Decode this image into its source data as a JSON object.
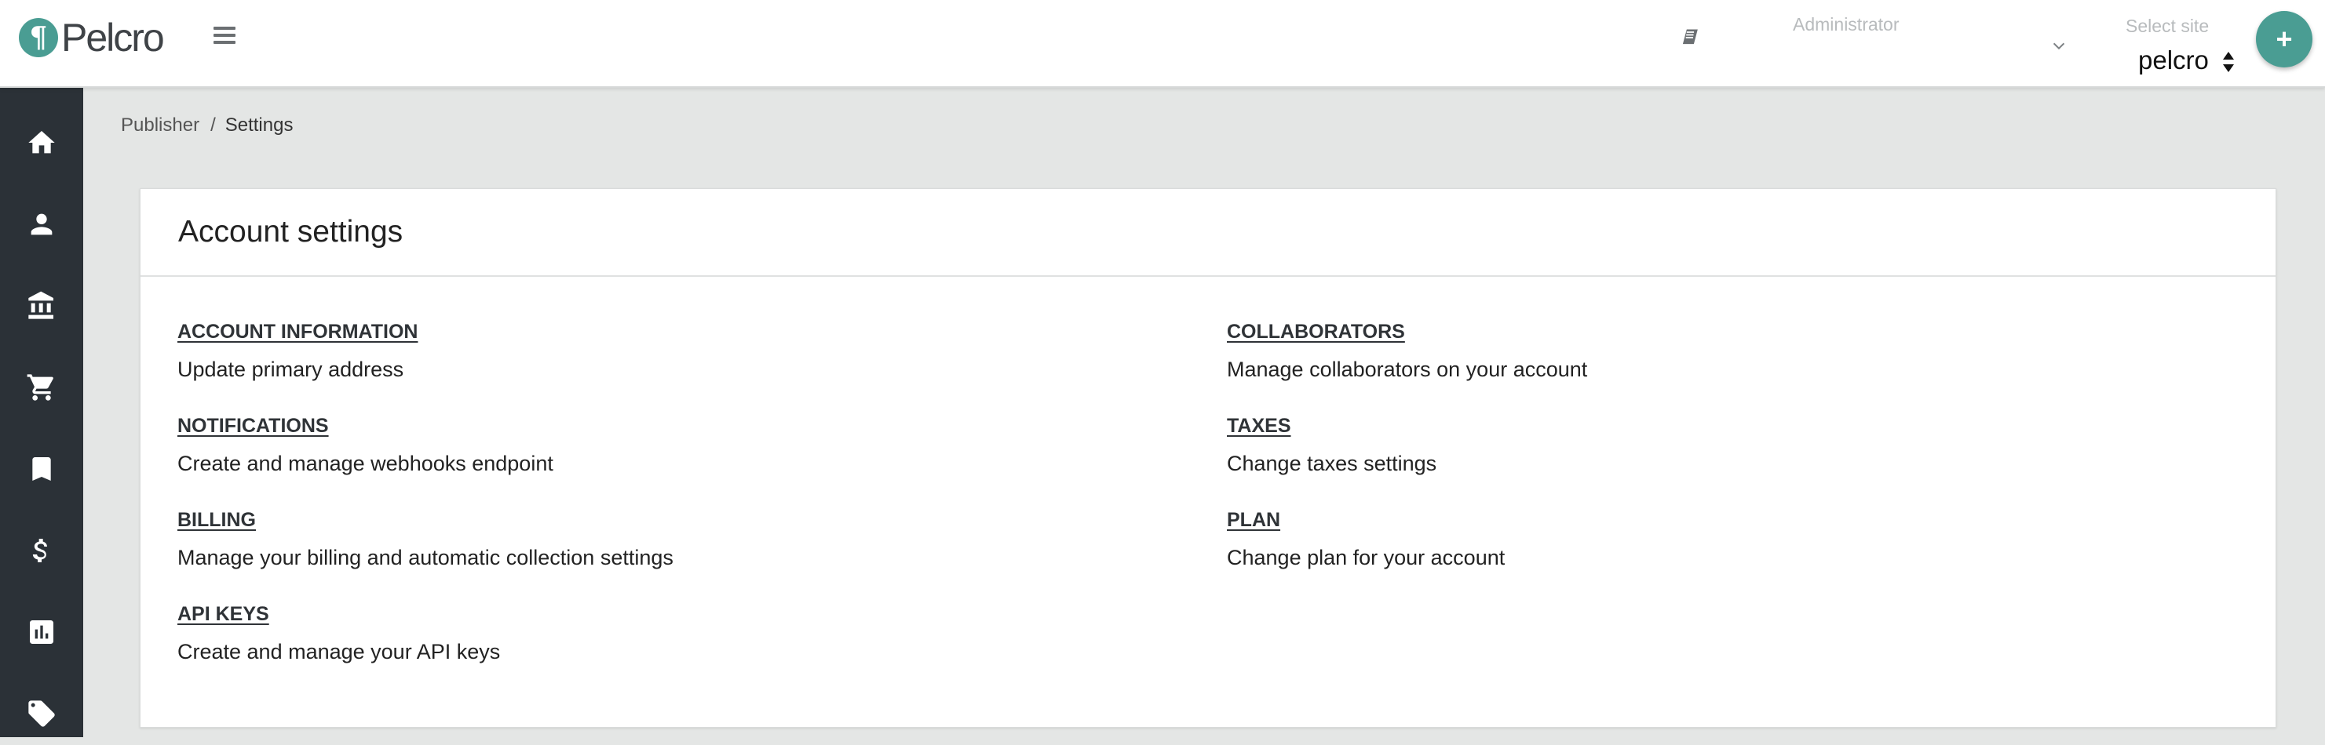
{
  "header": {
    "logo_mark": "¶",
    "logo_text": "Pelcro",
    "role_placeholder": "Administrator",
    "site_label": "Select site",
    "site_value": "pelcro",
    "add_label": "+"
  },
  "sidebar": {
    "items": [
      {
        "icon": "home-icon"
      },
      {
        "icon": "person-icon"
      },
      {
        "icon": "bank-icon"
      },
      {
        "icon": "cart-icon"
      },
      {
        "icon": "bookmark-icon"
      },
      {
        "icon": "dollar-icon"
      },
      {
        "icon": "chart-icon"
      },
      {
        "icon": "ticket-icon"
      }
    ]
  },
  "breadcrumb": {
    "parent": "Publisher",
    "separator": "/",
    "current": "Settings"
  },
  "card": {
    "title": "Account settings",
    "left": [
      {
        "link": "ACCOUNT INFORMATION",
        "desc": "Update primary address"
      },
      {
        "link": "NOTIFICATIONS",
        "desc": "Create and manage webhooks endpoint"
      },
      {
        "link": "BILLING",
        "desc": "Manage your billing and automatic collection settings"
      },
      {
        "link": "API KEYS",
        "desc": "Create and manage your API keys"
      }
    ],
    "right": [
      {
        "link": "COLLABORATORS",
        "desc": "Manage collaborators on your account"
      },
      {
        "link": "TAXES",
        "desc": "Change taxes settings"
      },
      {
        "link": "PLAN",
        "desc": "Change plan for your account"
      }
    ]
  },
  "colors": {
    "brand": "#4a9d93",
    "sidebar": "#2b3137",
    "background": "#e4e6e5"
  }
}
